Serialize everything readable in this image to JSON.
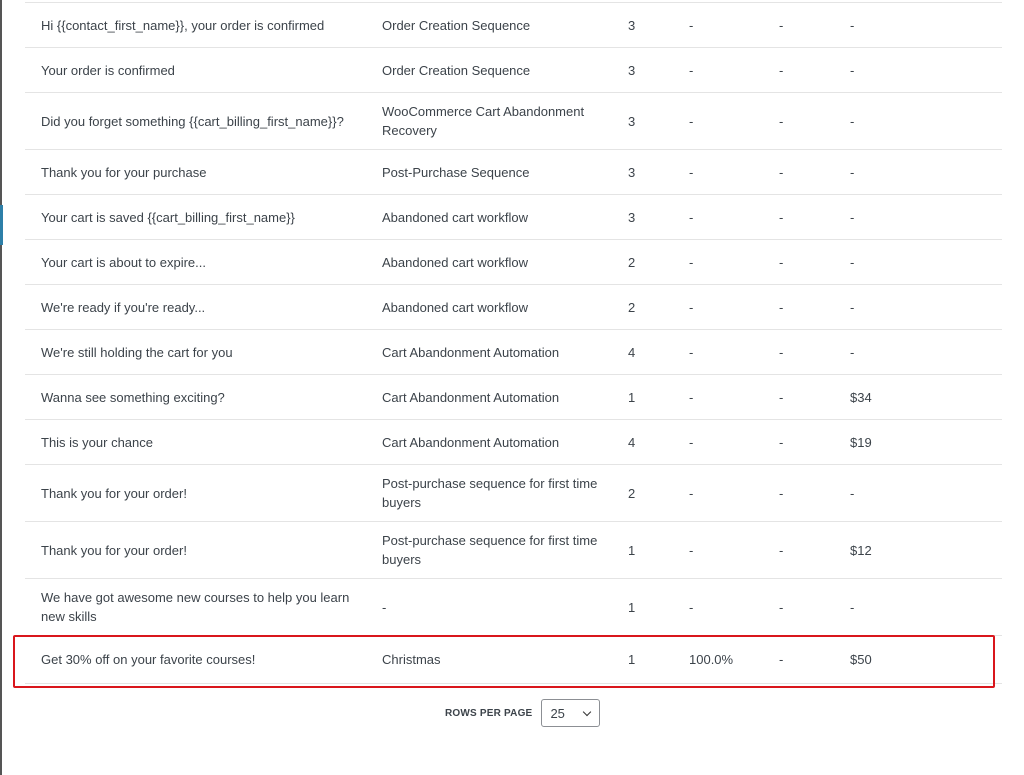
{
  "rows": [
    {
      "title": "Hi {{contact_first_name}}, your order is confirmed",
      "sequence": "Order Creation Sequence",
      "c3": "3",
      "c4": "-",
      "c5": "-",
      "c6": "-"
    },
    {
      "title": "Your order is confirmed",
      "sequence": "Order Creation Sequence",
      "c3": "3",
      "c4": "-",
      "c5": "-",
      "c6": "-"
    },
    {
      "title": "Did you forget something {{cart_billing_first_name}}?",
      "sequence": "WooCommerce Cart Abandonment Recovery",
      "c3": "3",
      "c4": "-",
      "c5": "-",
      "c6": "-"
    },
    {
      "title": "Thank you for your purchase",
      "sequence": "Post-Purchase Sequence",
      "c3": "3",
      "c4": "-",
      "c5": "-",
      "c6": "-"
    },
    {
      "title": "Your cart is saved {{cart_billing_first_name}}",
      "sequence": "Abandoned cart workflow",
      "c3": "3",
      "c4": "-",
      "c5": "-",
      "c6": "-"
    },
    {
      "title": "Your cart is about to expire...",
      "sequence": "Abandoned cart workflow",
      "c3": "2",
      "c4": "-",
      "c5": "-",
      "c6": "-"
    },
    {
      "title": "We're ready if you're ready...",
      "sequence": "Abandoned cart workflow",
      "c3": "2",
      "c4": "-",
      "c5": "-",
      "c6": "-"
    },
    {
      "title": "We're still holding the cart for you",
      "sequence": "Cart Abandonment Automation",
      "c3": "4",
      "c4": "-",
      "c5": "-",
      "c6": "-"
    },
    {
      "title": "Wanna see something exciting?",
      "sequence": "Cart Abandonment Automation",
      "c3": "1",
      "c4": "-",
      "c5": "-",
      "c6": "$34"
    },
    {
      "title": "This is your chance",
      "sequence": "Cart Abandonment Automation",
      "c3": "4",
      "c4": "-",
      "c5": "-",
      "c6": "$19"
    },
    {
      "title": "Thank you for your order!",
      "sequence": "Post-purchase sequence for first time buyers",
      "c3": "2",
      "c4": "-",
      "c5": "-",
      "c6": "-"
    },
    {
      "title": "Thank you for your order!",
      "sequence": "Post-purchase sequence for first time buyers",
      "c3": "1",
      "c4": "-",
      "c5": "-",
      "c6": "$12"
    },
    {
      "title": "We have got awesome new courses to help you learn new skills",
      "sequence": "-",
      "c3": "1",
      "c4": "-",
      "c5": "-",
      "c6": "-"
    },
    {
      "title": "Get 30% off on your favorite courses!",
      "sequence": "Christmas",
      "c3": "1",
      "c4": "100.0%",
      "c5": "-",
      "c6": "$50",
      "highlighted": true
    }
  ],
  "pagination": {
    "rows_per_page_label": "ROWS PER PAGE",
    "rows_per_page_value": "25"
  },
  "colors": {
    "highlight": "#d9161c",
    "divider": "#e4e4e4"
  }
}
